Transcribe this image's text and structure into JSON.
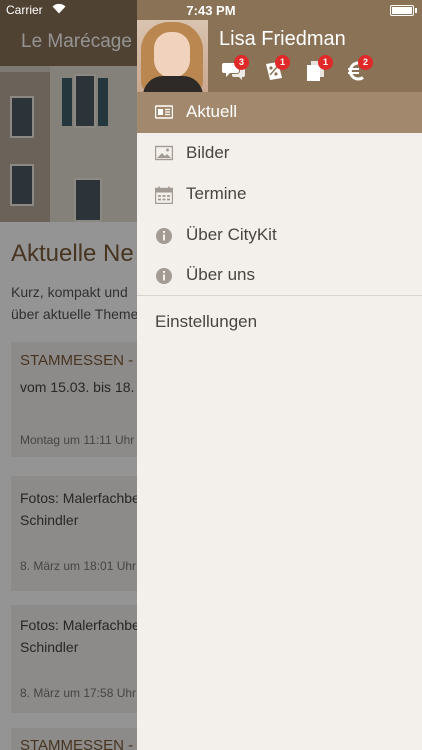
{
  "status_bar": {
    "carrier": "Carrier",
    "time": "7:43 PM"
  },
  "background": {
    "app_title": "Le Marécage",
    "heading": "Aktuelle Ne",
    "intro_lines": [
      "Kurz, kompakt und",
      "über aktuelle Theme"
    ],
    "cards": [
      {
        "title": "STAMMESSEN -",
        "text_lines": [
          "vom 15.03. bis 18."
        ],
        "date": "Montag um 11:11 Uhr"
      },
      {
        "title": "",
        "text_lines": [
          "Fotos: Malerfachbe",
          "Schindler"
        ],
        "date": "8. März um 18:01 Uhr"
      },
      {
        "title": "",
        "text_lines": [
          "Fotos: Malerfachbe",
          "Schindler"
        ],
        "date": "8. März um 17:58 Uhr"
      },
      {
        "title": "STAMMESSEN -",
        "text_lines": [],
        "date": ""
      }
    ]
  },
  "menu": {
    "user_name": "Lisa Friedman",
    "header_icons": [
      {
        "icon": "chat-bubbles-icon",
        "badge": "3"
      },
      {
        "icon": "coupon-icon",
        "badge": "1"
      },
      {
        "icon": "documents-icon",
        "badge": "1"
      },
      {
        "icon": "euro-icon",
        "badge": "2"
      }
    ],
    "items": [
      {
        "label": "Aktuell",
        "icon": "newspaper-icon",
        "active": true
      },
      {
        "label": "Bilder",
        "icon": "image-icon",
        "active": false
      },
      {
        "label": "Termine",
        "icon": "calendar-icon",
        "active": false
      },
      {
        "label": "Über CityKit",
        "icon": "info-icon",
        "active": false
      },
      {
        "label": "Über uns",
        "icon": "info-icon",
        "active": false
      }
    ],
    "settings_label": "Einstellungen"
  },
  "colors": {
    "header_brown": "#8a7256",
    "active_item": "#a2896e",
    "menu_background": "#f3efeb",
    "badge_red": "#e02a2a",
    "icon_gray": "#a29b93"
  }
}
